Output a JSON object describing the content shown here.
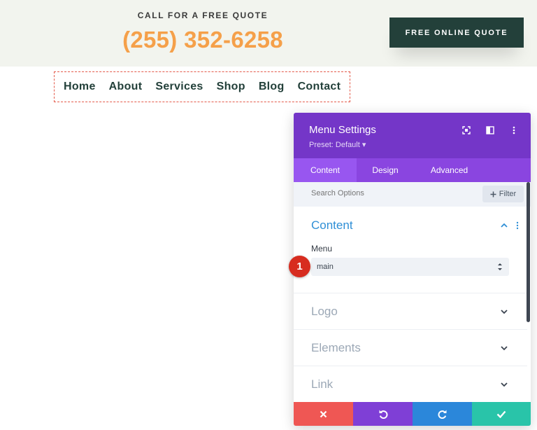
{
  "header": {
    "cta_label": "CALL FOR A FREE QUOTE",
    "phone": "(255) 352-6258",
    "quote_button": "FREE ONLINE QUOTE"
  },
  "nav": {
    "items": [
      "Home",
      "About",
      "Services",
      "Shop",
      "Blog",
      "Contact"
    ]
  },
  "panel": {
    "title": "Menu Settings",
    "preset": "Preset: Default ▾",
    "tabs": [
      {
        "label": "Content",
        "active": true
      },
      {
        "label": "Design",
        "active": false
      },
      {
        "label": "Advanced",
        "active": false
      }
    ],
    "search_placeholder": "Search Options",
    "filter_label": "Filter",
    "sections": {
      "content": {
        "title": "Content",
        "field_label": "Menu",
        "select_value": "main"
      },
      "logo": {
        "title": "Logo"
      },
      "elements": {
        "title": "Elements"
      },
      "link": {
        "title": "Link"
      }
    },
    "badge": "1"
  },
  "colors": {
    "header_bg": "#f2f4ee",
    "phone": "#f5a04a",
    "dark_green": "#23403a",
    "panel_purple": "#7436c8",
    "tab_purple": "#8a45e0",
    "accent_blue": "#2f8fd6",
    "cancel_red": "#ef5754",
    "undo_purple": "#7f3fd6",
    "redo_blue": "#2b87da",
    "save_green": "#29c4a9"
  },
  "icons": [
    "expand-icon",
    "columns-icon",
    "kebab-icon",
    "plus-icon",
    "chevron-up-icon",
    "chevron-down-icon",
    "close-icon",
    "undo-icon",
    "redo-icon",
    "check-icon"
  ]
}
